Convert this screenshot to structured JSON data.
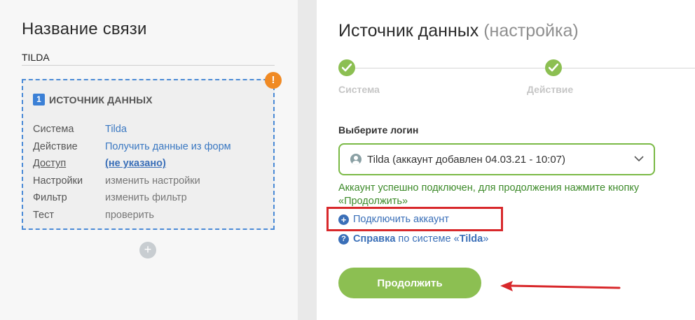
{
  "left": {
    "title": "Название связи",
    "connection_name": "TILDA",
    "warning_badge": "!",
    "card": {
      "step_number": "1",
      "header": "ИСТОЧНИК ДАННЫХ",
      "rows": [
        {
          "key": "Система",
          "value": "Tilda"
        },
        {
          "key": "Действие",
          "value": "Получить данные из форм"
        },
        {
          "key": "Доступ",
          "value": "(не указано)"
        },
        {
          "key": "Настройки",
          "value": "изменить настройки"
        },
        {
          "key": "Фильтр",
          "value": "изменить фильтр"
        },
        {
          "key": "Тест",
          "value": "проверить"
        }
      ]
    },
    "add_button": "+"
  },
  "right": {
    "title_main": "Источник данных",
    "title_sub": "(настройка)",
    "steps": [
      {
        "label": "Система",
        "done": true
      },
      {
        "label": "Действие",
        "done": true
      }
    ],
    "login_label": "Выберите логин",
    "login_value": "Tilda (аккаунт добавлен 04.03.21 - 10:07)",
    "success_message": "Аккаунт успешно подключен, для продолжения нажмите кнопку «Продолжить»",
    "connect_account": "Подключить аккаунт",
    "help_prefix": "Справка",
    "help_middle": " по системе «",
    "help_system": "Tilda",
    "help_suffix": "»",
    "continue_label": "Продолжить"
  },
  "colors": {
    "accent_green": "#8cbf52",
    "link_blue": "#3a6fb8",
    "warning_orange": "#f08a24",
    "highlight_red": "#d8282b"
  }
}
